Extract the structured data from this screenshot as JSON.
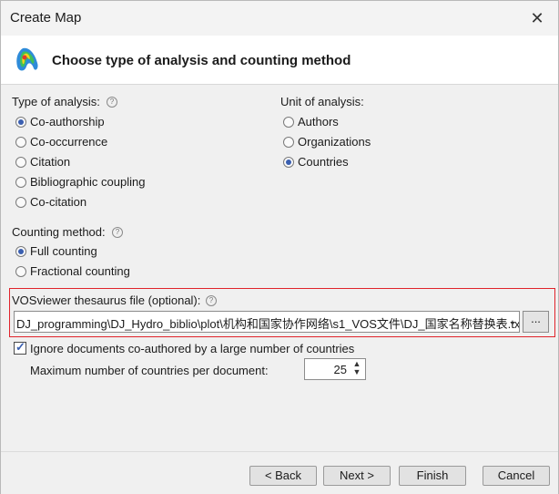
{
  "window": {
    "title": "Create Map",
    "close_glyph": "✕"
  },
  "header": {
    "title": "Choose type of analysis and counting method",
    "logo": "vosviewer-logo-icon"
  },
  "type_of_analysis": {
    "label": "Type of analysis:",
    "options": [
      {
        "label": "Co-authorship",
        "selected": true
      },
      {
        "label": "Co-occurrence",
        "selected": false
      },
      {
        "label": "Citation",
        "selected": false
      },
      {
        "label": "Bibliographic coupling",
        "selected": false
      },
      {
        "label": "Co-citation",
        "selected": false
      }
    ]
  },
  "unit_of_analysis": {
    "label": "Unit of analysis:",
    "options": [
      {
        "label": "Authors",
        "selected": false
      },
      {
        "label": "Organizations",
        "selected": false
      },
      {
        "label": "Countries",
        "selected": true
      }
    ]
  },
  "counting_method": {
    "label": "Counting method:",
    "options": [
      {
        "label": "Full counting",
        "selected": true
      },
      {
        "label": "Fractional counting",
        "selected": false
      }
    ]
  },
  "thesaurus": {
    "label": "VOSviewer thesaurus file (optional):",
    "path": "DJ_programming\\DJ_Hydro_biblio\\plot\\机构和国家协作网络\\s1_VOS文件\\DJ_国家名称替换表.txt",
    "browse_label": "...",
    "dropdown_glyph": "⌄"
  },
  "ignore_documents": {
    "label": "Ignore documents co-authored by a large number of countries",
    "checked": true
  },
  "max_countries": {
    "label": "Maximum number of countries per document:",
    "value": "25"
  },
  "help_glyph": "?",
  "buttons": {
    "back": "< Back",
    "next": "Next >",
    "finish": "Finish",
    "cancel": "Cancel"
  },
  "colors": {
    "accent": "#3a5fb0",
    "highlight_border": "#e0232b"
  }
}
